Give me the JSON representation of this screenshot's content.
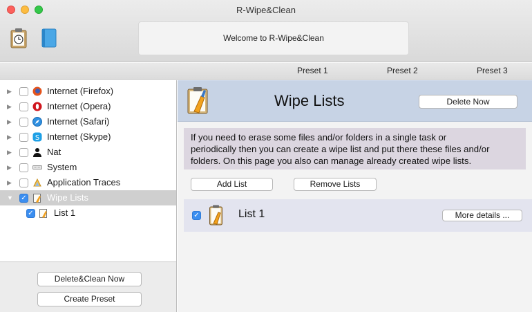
{
  "window": {
    "title": "R-Wipe&Clean"
  },
  "toolbar": {
    "welcome": "Welcome to R-Wipe&Clean"
  },
  "presets": [
    "Preset 1",
    "Preset 2",
    "Preset 3"
  ],
  "sidebar": {
    "items": [
      {
        "label": "Internet (Firefox)",
        "icon": "firefox-icon",
        "checked": false
      },
      {
        "label": "Internet (Opera)",
        "icon": "opera-icon",
        "checked": false
      },
      {
        "label": "Internet (Safari)",
        "icon": "safari-icon",
        "checked": false
      },
      {
        "label": "Internet (Skype)",
        "icon": "skype-icon",
        "checked": false
      },
      {
        "label": "Nat",
        "icon": "user-icon",
        "checked": false
      },
      {
        "label": "System",
        "icon": "system-icon",
        "checked": false
      },
      {
        "label": "Application Traces",
        "icon": "application-icon",
        "checked": false
      },
      {
        "label": "Wipe Lists",
        "icon": "wipe-list-icon",
        "checked": true,
        "selected": true
      },
      {
        "label": "List 1",
        "icon": "wipe-list-icon",
        "checked": true
      }
    ],
    "delete_clean_label": "Delete&Clean Now",
    "create_preset_label": "Create Preset"
  },
  "main": {
    "title": "Wipe Lists",
    "delete_now_label": "Delete Now",
    "info_lines": [
      "If you need to erase some files and/or folders in a single task or",
      "periodically then you can create a wipe list and put there these files and/or",
      "folders. On this page you also can manage already created wipe lists."
    ],
    "add_list_label": "Add List",
    "remove_lists_label": "Remove Lists",
    "lists": [
      {
        "name": "List 1",
        "checked": true,
        "details_label": "More details ..."
      }
    ]
  },
  "colors": {
    "header_blue": "#c7d3e5",
    "info_bg": "#dcd6e0",
    "list_row_bg": "#e3e4ef",
    "checkbox_blue": "#3b8ef0"
  }
}
